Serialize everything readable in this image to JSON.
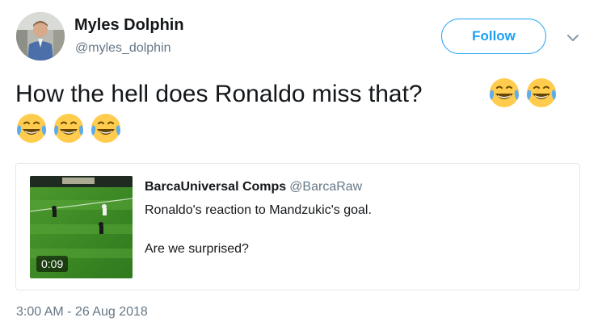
{
  "author": {
    "name": "Myles Dolphin",
    "handle": "@myles_dolphin"
  },
  "actions": {
    "follow_label": "Follow"
  },
  "tweet": {
    "text": "How the hell does Ronaldo miss that?",
    "emoji": [
      "face-with-tears-of-joy",
      "face-with-tears-of-joy",
      "face-with-tears-of-joy",
      "face-with-tears-of-joy",
      "face-with-tears-of-joy"
    ]
  },
  "quoted_tweet": {
    "name": "BarcaUniversal Comps",
    "handle": "@BarcaRaw",
    "line1": "Ronaldo's reaction to Mandzukic's goal.",
    "line2": "Are we surprised?",
    "video_duration": "0:09"
  },
  "timestamp": "3:00 AM - 26 Aug 2018",
  "colors": {
    "accent": "#1da1f2",
    "secondary_text": "#657786",
    "border": "#e1e8ed"
  }
}
